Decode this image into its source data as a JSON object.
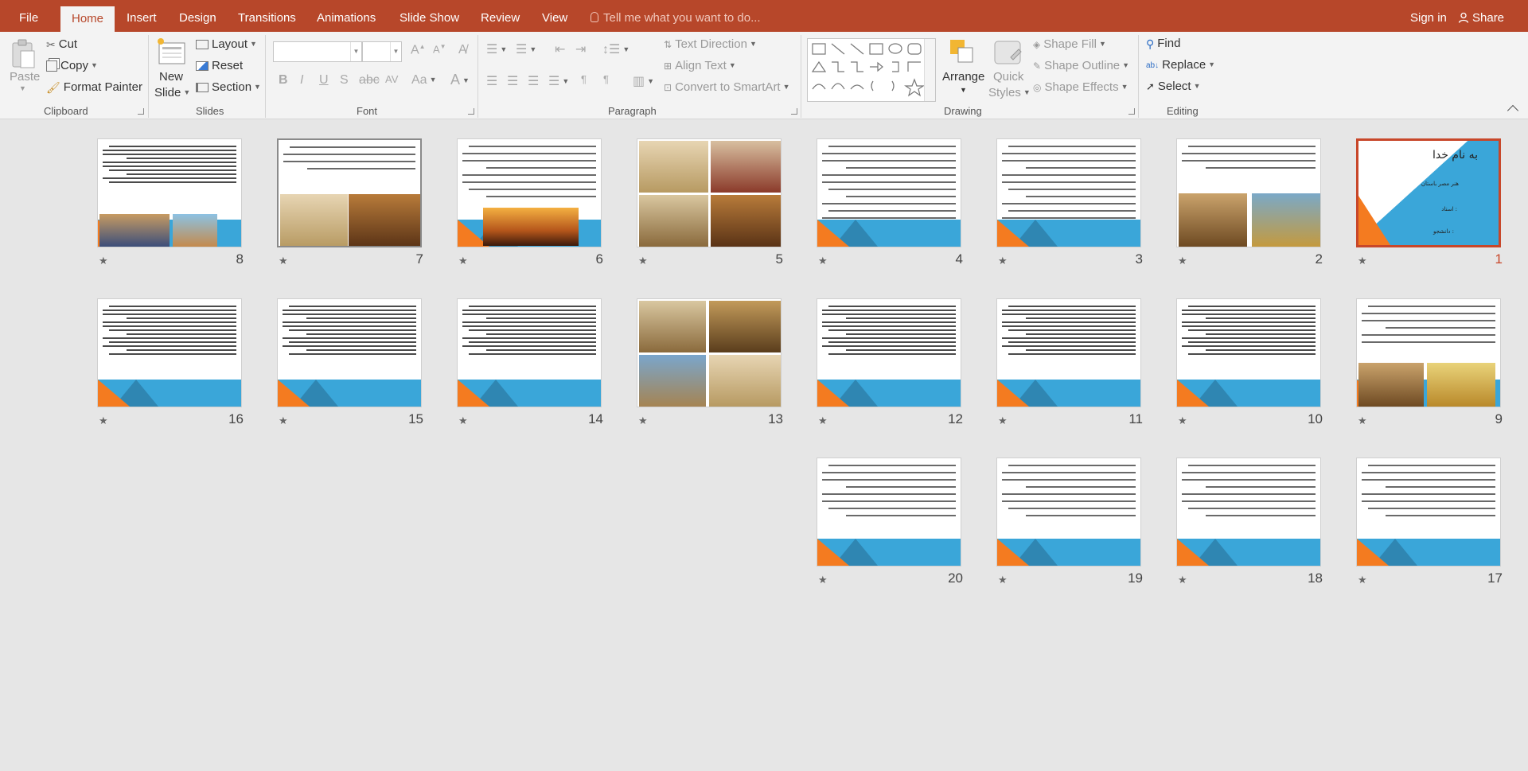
{
  "menu": {
    "tabs": [
      "File",
      "Home",
      "Insert",
      "Design",
      "Transitions",
      "Animations",
      "Slide Show",
      "Review",
      "View"
    ],
    "active": "Home",
    "tell_me": "Tell me what you want to do...",
    "sign_in": "Sign in",
    "share": "Share"
  },
  "ribbon": {
    "clipboard": {
      "label": "Clipboard",
      "paste": "Paste",
      "cut": "Cut",
      "copy": "Copy",
      "format_painter": "Format Painter"
    },
    "slides": {
      "label": "Slides",
      "new_slide_1": "New",
      "new_slide_2": "Slide",
      "layout": "Layout",
      "reset": "Reset",
      "section": "Section"
    },
    "font": {
      "label": "Font"
    },
    "paragraph": {
      "label": "Paragraph",
      "text_direction": "Text Direction",
      "align_text": "Align Text",
      "convert_smartart": "Convert to SmartArt"
    },
    "drawing": {
      "label": "Drawing",
      "arrange": "Arrange",
      "quick_styles_1": "Quick",
      "quick_styles_2": "Styles",
      "shape_fill": "Shape Fill",
      "shape_outline": "Shape Outline",
      "shape_effects": "Shape Effects"
    },
    "editing": {
      "label": "Editing",
      "find": "Find",
      "replace": "Replace",
      "select": "Select"
    }
  },
  "slides": [
    {
      "n": "1",
      "kind": "title",
      "title": "به نام خدا",
      "sub1": "هنر مصر باستان",
      "sub2": "استاد :",
      "sub3": "دانشجو :"
    },
    {
      "n": "2",
      "kind": "text-img2"
    },
    {
      "n": "3",
      "kind": "text"
    },
    {
      "n": "4",
      "kind": "text"
    },
    {
      "n": "5",
      "kind": "img4"
    },
    {
      "n": "6",
      "kind": "text-img1"
    },
    {
      "n": "7",
      "kind": "text-img2b"
    },
    {
      "n": "8",
      "kind": "dense-img2"
    },
    {
      "n": "9",
      "kind": "text-img2c"
    },
    {
      "n": "10",
      "kind": "dense"
    },
    {
      "n": "11",
      "kind": "dense"
    },
    {
      "n": "12",
      "kind": "dense"
    },
    {
      "n": "13",
      "kind": "img4b"
    },
    {
      "n": "14",
      "kind": "dense"
    },
    {
      "n": "15",
      "kind": "dense"
    },
    {
      "n": "16",
      "kind": "dense"
    },
    {
      "n": "17",
      "kind": "sparse"
    },
    {
      "n": "18",
      "kind": "sparse"
    },
    {
      "n": "19",
      "kind": "sparse"
    },
    {
      "n": "20",
      "kind": "sparse"
    }
  ],
  "colors": {
    "accent": "#b7472a",
    "slide_blue": "#3aa6d9",
    "slide_orange": "#f47b20",
    "selected_border": "#c8472a"
  }
}
